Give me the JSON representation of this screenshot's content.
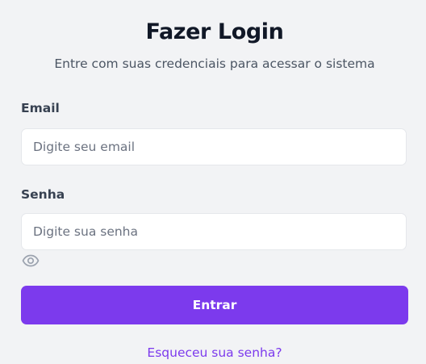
{
  "login": {
    "title": "Fazer Login",
    "subtitle": "Entre com suas credenciais para acessar o sistema",
    "email_label": "Email",
    "email_placeholder": "Digite seu email",
    "password_label": "Senha",
    "password_placeholder": "Digite sua senha",
    "password_toggle_icon": "eye-icon",
    "submit_label": "Entrar",
    "forgot_password_label": "Esqueceu sua senha?"
  },
  "colors": {
    "background": "#f2f3f5",
    "accent": "#7c3aed",
    "input_border": "#e5e7eb",
    "placeholder": "#6b7280"
  }
}
